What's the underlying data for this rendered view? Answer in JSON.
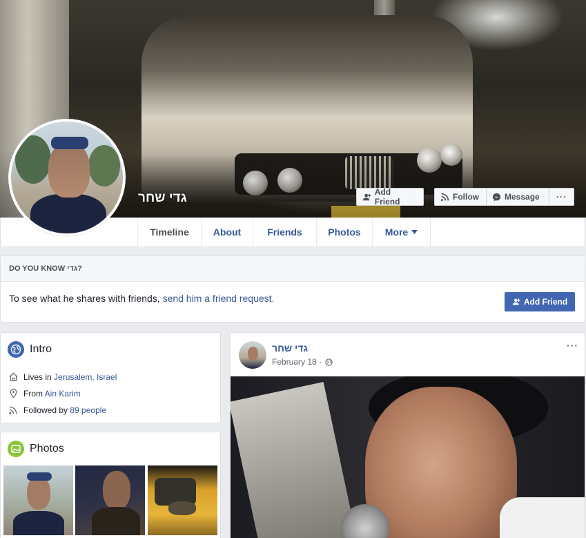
{
  "profile": {
    "name": "גדי שחר"
  },
  "header_buttons": {
    "add_friend": "Add Friend",
    "follow": "Follow",
    "message": "Message",
    "more": "···"
  },
  "tabs": [
    {
      "label": "Timeline",
      "active": true
    },
    {
      "label": "About",
      "active": false
    },
    {
      "label": "Friends",
      "active": false
    },
    {
      "label": "Photos",
      "active": false
    },
    {
      "label": "More",
      "active": false,
      "has_dropdown": true
    }
  ],
  "do_you_know": {
    "heading": "DO YOU KNOW גדי?",
    "text": "To see what he shares with friends, ",
    "link": "send him a friend request.",
    "button": "Add Friend"
  },
  "intro": {
    "title": "Intro",
    "lives_in_prefix": "Lives in ",
    "city": "Jerusalem, Israel",
    "from_prefix": "From ",
    "from_place": "Ain Karim",
    "followed_prefix": "Followed by ",
    "followed_link": "89 people"
  },
  "photos": {
    "title": "Photos"
  },
  "post": {
    "author": "גדי שחר",
    "date": "February 18",
    "separator": "·",
    "options": "···"
  },
  "colors": {
    "link_blue": "#365899",
    "button_blue": "#4267b2",
    "page_bg": "#e9ebee"
  },
  "icons": [
    "add-friend-icon",
    "rss-icon",
    "messenger-icon",
    "globe-icon",
    "home-icon",
    "location-pin-icon",
    "photo-icon",
    "chevron-down-icon"
  ]
}
